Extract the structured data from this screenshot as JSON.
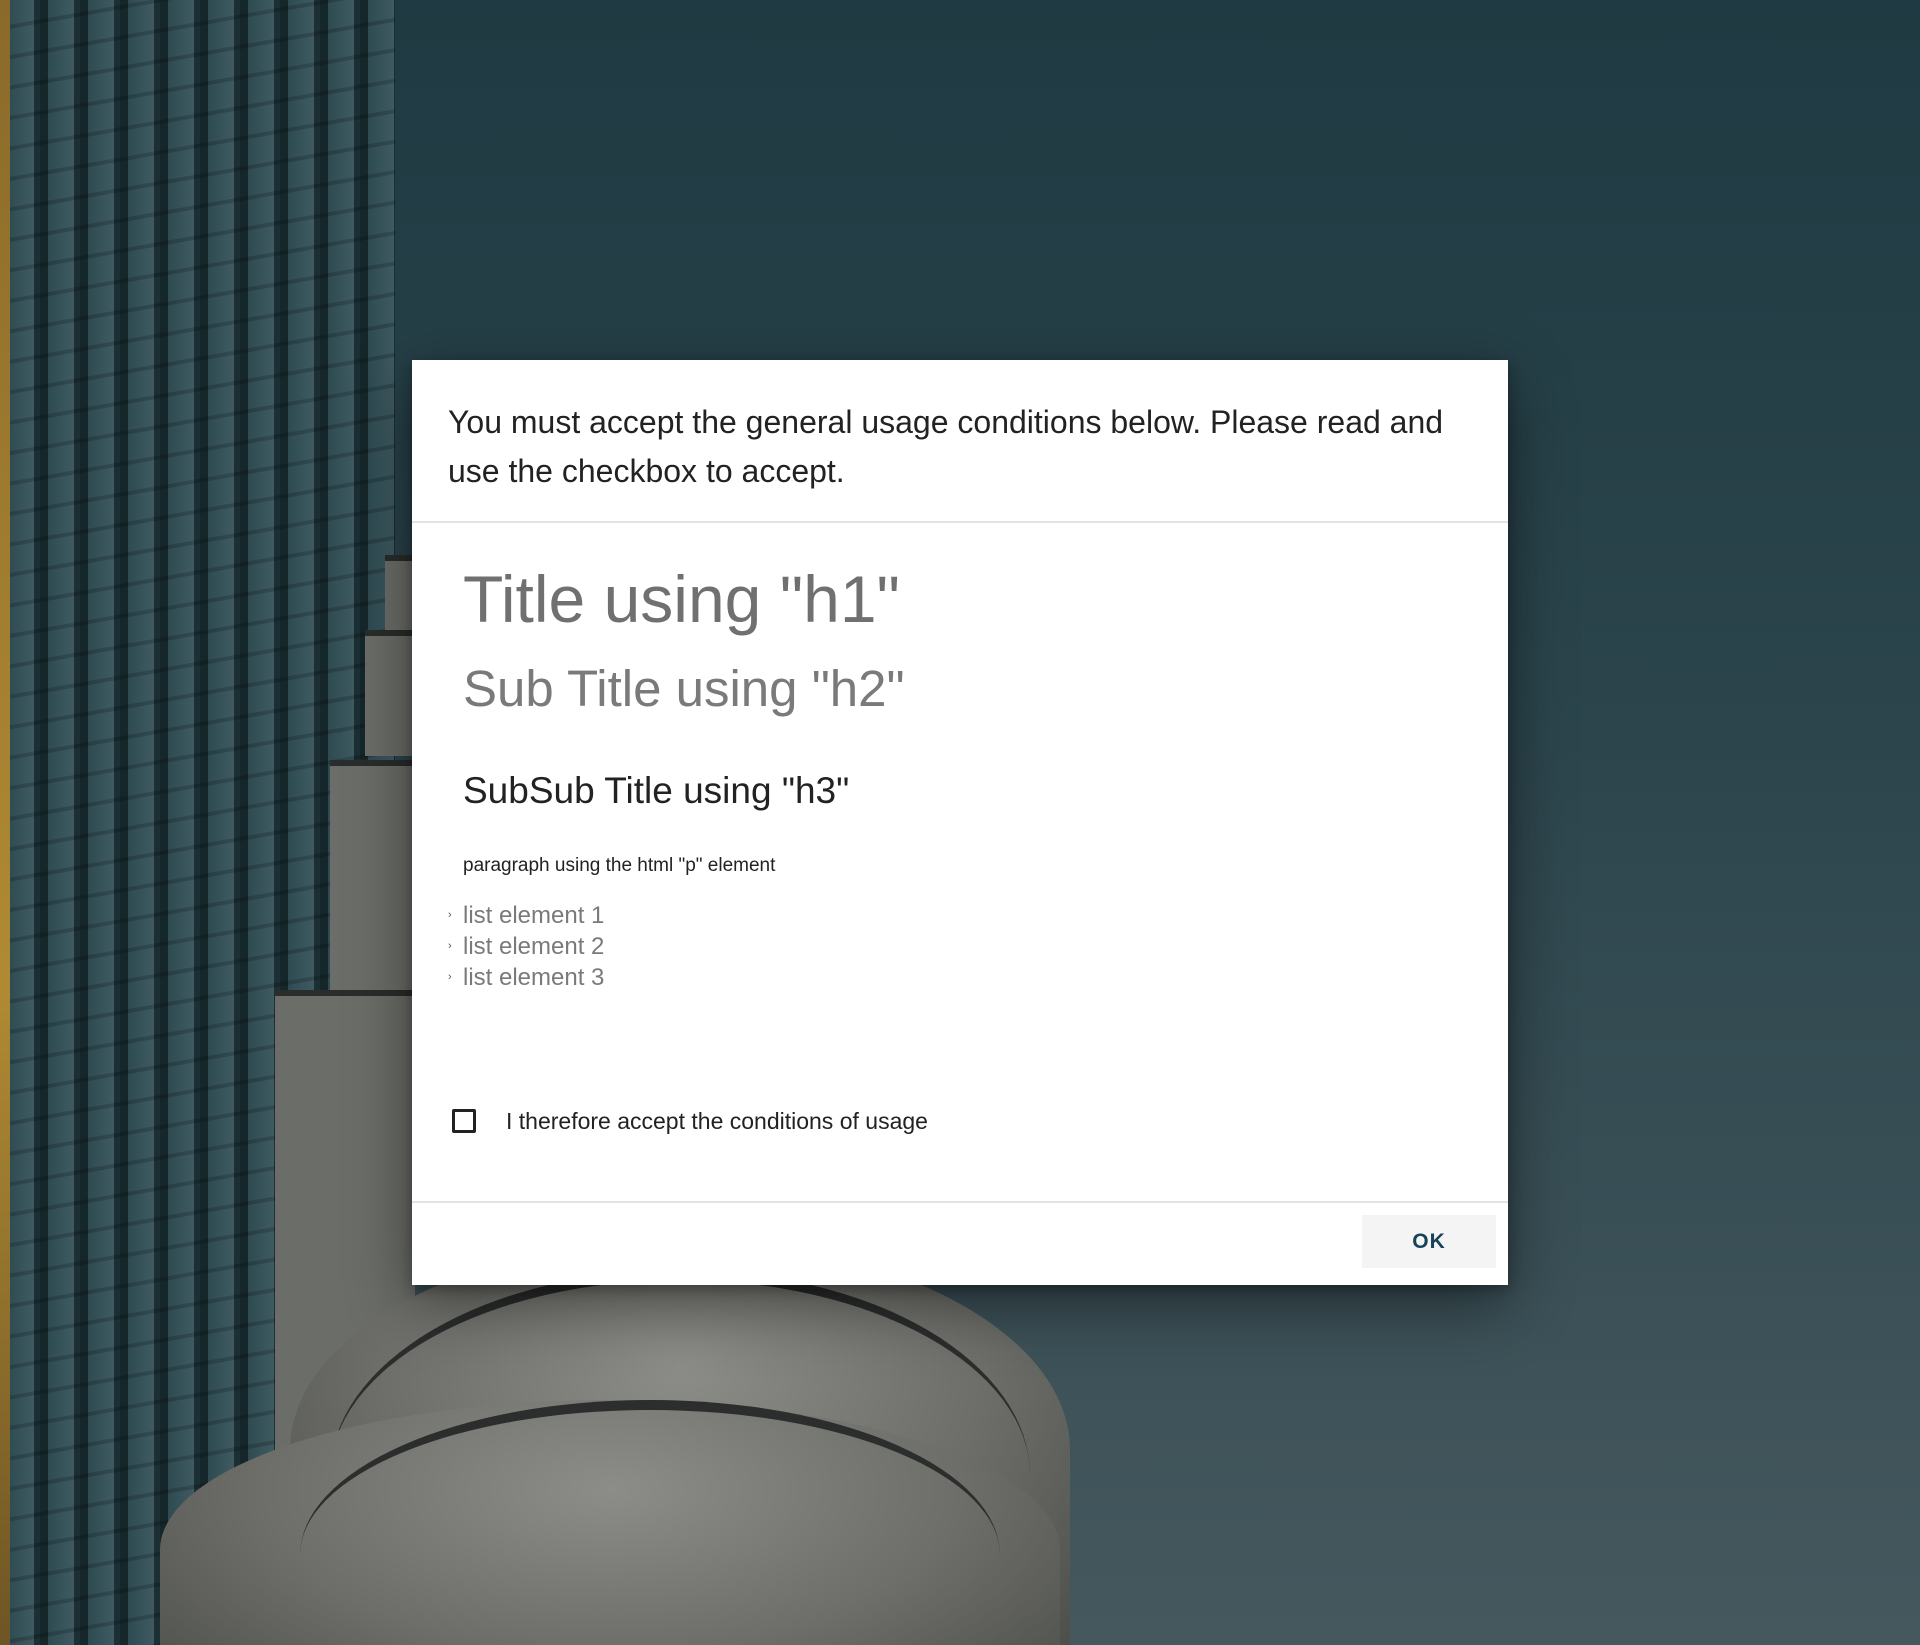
{
  "dialog": {
    "header_text": "You must accept the general usage conditions below. Please read and use the checkbox to accept.",
    "content": {
      "h1": "Title using \"h1\"",
      "h2": "Sub Title using \"h2\"",
      "h3": "SubSub Title using \"h3\"",
      "paragraph": "paragraph using the html \"p\" element",
      "list_items": [
        "list element 1",
        "list element 2",
        "list element 3"
      ]
    },
    "checkbox": {
      "label": "I therefore accept the conditions of usage",
      "checked": false
    },
    "ok_label": "OK"
  },
  "colors": {
    "button_text": "#16435a",
    "background_top": "#1f3a42",
    "background_bottom": "#45585e"
  }
}
